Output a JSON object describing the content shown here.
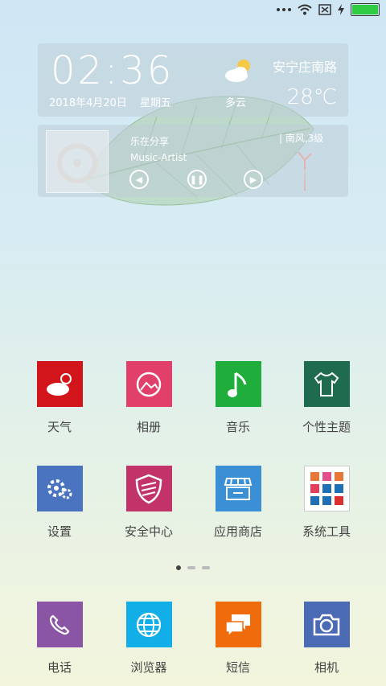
{
  "clock_widget": {
    "time": "02:36",
    "date": "2018年4月20日",
    "weekday": "星期五",
    "weather_desc": "多云",
    "location": "安宁庄南路",
    "temperature": "28℃"
  },
  "music_widget": {
    "song": "乐在分享",
    "artist": "Music-Artist",
    "wind": "| 南风,3级"
  },
  "apps_row1": [
    {
      "label": "天气",
      "color": "#d2141b"
    },
    {
      "label": "相册",
      "color": "#e0406a"
    },
    {
      "label": "音乐",
      "color": "#1fae3b"
    },
    {
      "label": "个性主题",
      "color": "#1f6b4f"
    }
  ],
  "apps_row2": [
    {
      "label": "设置",
      "color": "#4a74c0"
    },
    {
      "label": "安全中心",
      "color": "#c2336a"
    },
    {
      "label": "应用商店",
      "color": "#3b8fd4"
    },
    {
      "label": "系统工具",
      "color": "#ffffff"
    }
  ],
  "dock": [
    {
      "label": "电话",
      "color": "#8a55a5"
    },
    {
      "label": "浏览器",
      "color": "#11aee8"
    },
    {
      "label": "短信",
      "color": "#ef6b0c"
    },
    {
      "label": "相机",
      "color": "#4a6ab4"
    }
  ]
}
